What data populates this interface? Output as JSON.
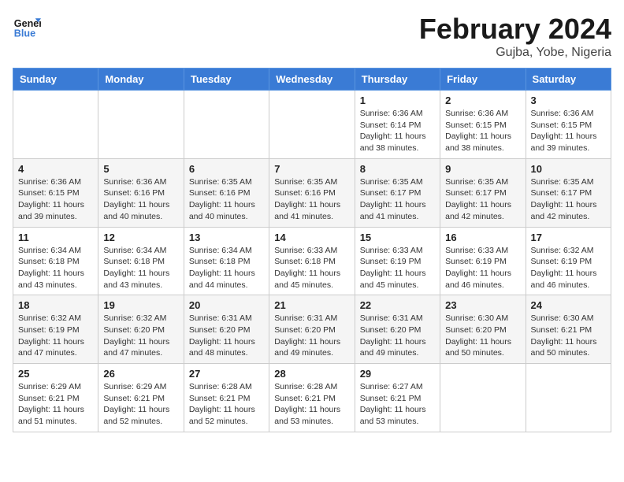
{
  "header": {
    "logo_line1": "General",
    "logo_line2": "Blue",
    "month": "February 2024",
    "location": "Gujba, Yobe, Nigeria"
  },
  "weekdays": [
    "Sunday",
    "Monday",
    "Tuesday",
    "Wednesday",
    "Thursday",
    "Friday",
    "Saturday"
  ],
  "weeks": [
    [
      {
        "day": "",
        "info": ""
      },
      {
        "day": "",
        "info": ""
      },
      {
        "day": "",
        "info": ""
      },
      {
        "day": "",
        "info": ""
      },
      {
        "day": "1",
        "info": "Sunrise: 6:36 AM\nSunset: 6:14 PM\nDaylight: 11 hours\nand 38 minutes."
      },
      {
        "day": "2",
        "info": "Sunrise: 6:36 AM\nSunset: 6:15 PM\nDaylight: 11 hours\nand 38 minutes."
      },
      {
        "day": "3",
        "info": "Sunrise: 6:36 AM\nSunset: 6:15 PM\nDaylight: 11 hours\nand 39 minutes."
      }
    ],
    [
      {
        "day": "4",
        "info": "Sunrise: 6:36 AM\nSunset: 6:15 PM\nDaylight: 11 hours\nand 39 minutes."
      },
      {
        "day": "5",
        "info": "Sunrise: 6:36 AM\nSunset: 6:16 PM\nDaylight: 11 hours\nand 40 minutes."
      },
      {
        "day": "6",
        "info": "Sunrise: 6:35 AM\nSunset: 6:16 PM\nDaylight: 11 hours\nand 40 minutes."
      },
      {
        "day": "7",
        "info": "Sunrise: 6:35 AM\nSunset: 6:16 PM\nDaylight: 11 hours\nand 41 minutes."
      },
      {
        "day": "8",
        "info": "Sunrise: 6:35 AM\nSunset: 6:17 PM\nDaylight: 11 hours\nand 41 minutes."
      },
      {
        "day": "9",
        "info": "Sunrise: 6:35 AM\nSunset: 6:17 PM\nDaylight: 11 hours\nand 42 minutes."
      },
      {
        "day": "10",
        "info": "Sunrise: 6:35 AM\nSunset: 6:17 PM\nDaylight: 11 hours\nand 42 minutes."
      }
    ],
    [
      {
        "day": "11",
        "info": "Sunrise: 6:34 AM\nSunset: 6:18 PM\nDaylight: 11 hours\nand 43 minutes."
      },
      {
        "day": "12",
        "info": "Sunrise: 6:34 AM\nSunset: 6:18 PM\nDaylight: 11 hours\nand 43 minutes."
      },
      {
        "day": "13",
        "info": "Sunrise: 6:34 AM\nSunset: 6:18 PM\nDaylight: 11 hours\nand 44 minutes."
      },
      {
        "day": "14",
        "info": "Sunrise: 6:33 AM\nSunset: 6:18 PM\nDaylight: 11 hours\nand 45 minutes."
      },
      {
        "day": "15",
        "info": "Sunrise: 6:33 AM\nSunset: 6:19 PM\nDaylight: 11 hours\nand 45 minutes."
      },
      {
        "day": "16",
        "info": "Sunrise: 6:33 AM\nSunset: 6:19 PM\nDaylight: 11 hours\nand 46 minutes."
      },
      {
        "day": "17",
        "info": "Sunrise: 6:32 AM\nSunset: 6:19 PM\nDaylight: 11 hours\nand 46 minutes."
      }
    ],
    [
      {
        "day": "18",
        "info": "Sunrise: 6:32 AM\nSunset: 6:19 PM\nDaylight: 11 hours\nand 47 minutes."
      },
      {
        "day": "19",
        "info": "Sunrise: 6:32 AM\nSunset: 6:20 PM\nDaylight: 11 hours\nand 47 minutes."
      },
      {
        "day": "20",
        "info": "Sunrise: 6:31 AM\nSunset: 6:20 PM\nDaylight: 11 hours\nand 48 minutes."
      },
      {
        "day": "21",
        "info": "Sunrise: 6:31 AM\nSunset: 6:20 PM\nDaylight: 11 hours\nand 49 minutes."
      },
      {
        "day": "22",
        "info": "Sunrise: 6:31 AM\nSunset: 6:20 PM\nDaylight: 11 hours\nand 49 minutes."
      },
      {
        "day": "23",
        "info": "Sunrise: 6:30 AM\nSunset: 6:20 PM\nDaylight: 11 hours\nand 50 minutes."
      },
      {
        "day": "24",
        "info": "Sunrise: 6:30 AM\nSunset: 6:21 PM\nDaylight: 11 hours\nand 50 minutes."
      }
    ],
    [
      {
        "day": "25",
        "info": "Sunrise: 6:29 AM\nSunset: 6:21 PM\nDaylight: 11 hours\nand 51 minutes."
      },
      {
        "day": "26",
        "info": "Sunrise: 6:29 AM\nSunset: 6:21 PM\nDaylight: 11 hours\nand 52 minutes."
      },
      {
        "day": "27",
        "info": "Sunrise: 6:28 AM\nSunset: 6:21 PM\nDaylight: 11 hours\nand 52 minutes."
      },
      {
        "day": "28",
        "info": "Sunrise: 6:28 AM\nSunset: 6:21 PM\nDaylight: 11 hours\nand 53 minutes."
      },
      {
        "day": "29",
        "info": "Sunrise: 6:27 AM\nSunset: 6:21 PM\nDaylight: 11 hours\nand 53 minutes."
      },
      {
        "day": "",
        "info": ""
      },
      {
        "day": "",
        "info": ""
      }
    ]
  ]
}
